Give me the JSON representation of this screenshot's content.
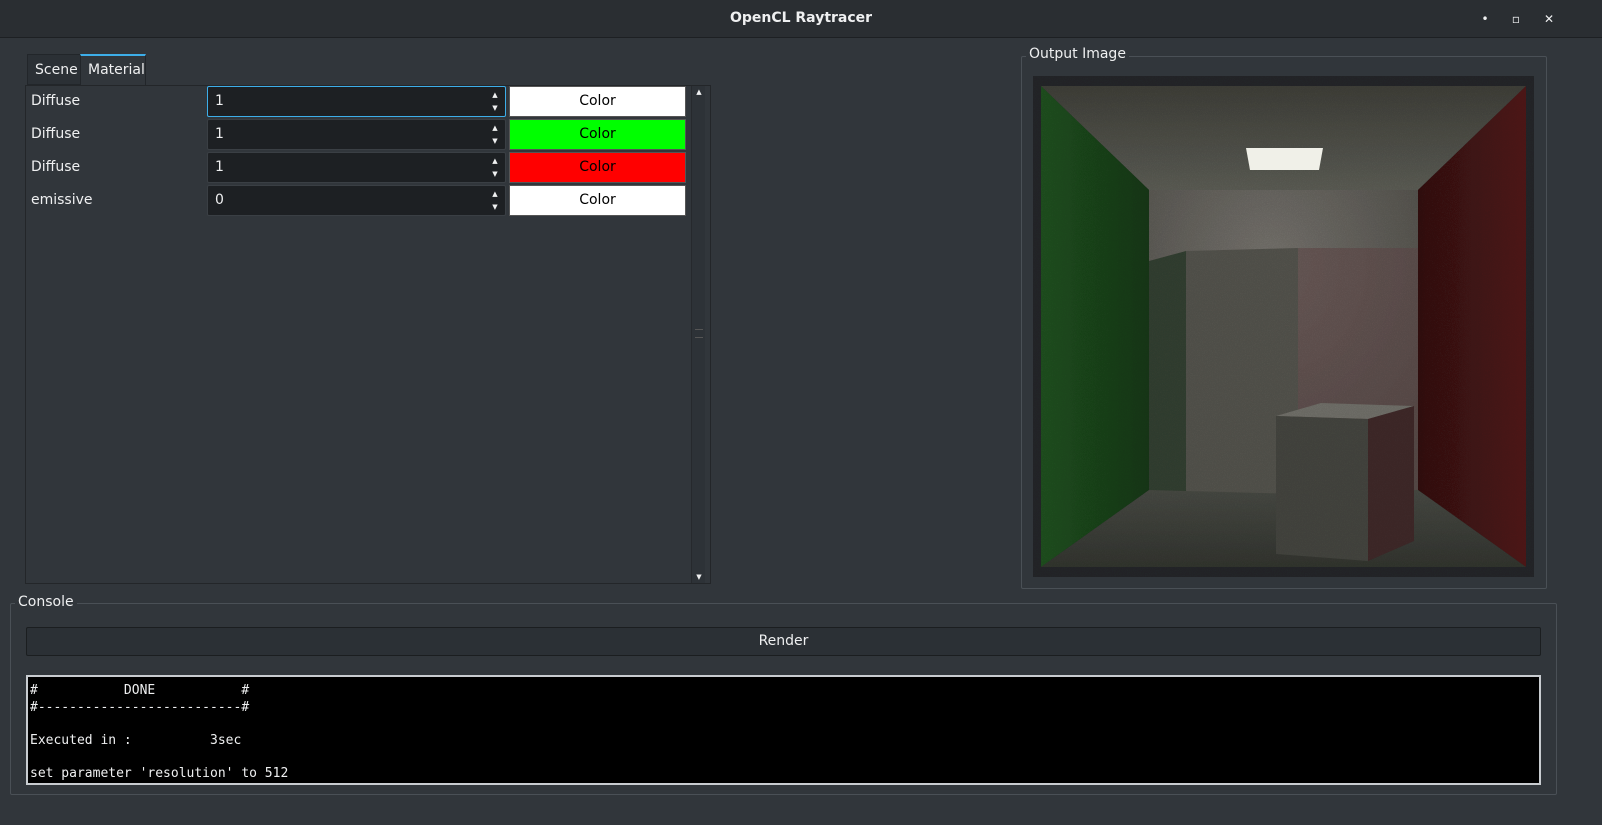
{
  "window": {
    "title": "OpenCL Raytracer",
    "controls": {
      "minimize": "•",
      "maximize": "▫",
      "close": "✕"
    }
  },
  "tabs": [
    {
      "label": "Scene",
      "active": false
    },
    {
      "label": "Material",
      "active": true
    }
  ],
  "materials": [
    {
      "label": "Diffuse",
      "value": "1",
      "button": "Color",
      "color": "#ffffff",
      "focused": true
    },
    {
      "label": "Diffuse",
      "value": "1",
      "button": "Color",
      "color": "#00ff00",
      "focused": false
    },
    {
      "label": "Diffuse",
      "value": "1",
      "button": "Color",
      "color": "#ff0000",
      "focused": false
    },
    {
      "label": "emissive",
      "value": "0",
      "button": "Color",
      "color": "#ffffff",
      "focused": false
    }
  ],
  "output": {
    "title": "Output Image"
  },
  "console": {
    "title": "Console",
    "render_label": "Render",
    "lines": [
      "#           DONE           #",
      "#--------------------------#",
      "",
      "Executed in :          3sec",
      "",
      "set parameter 'resolution' to 512"
    ]
  },
  "colors": {
    "accent": "#3daee9",
    "background": "#31363b"
  }
}
